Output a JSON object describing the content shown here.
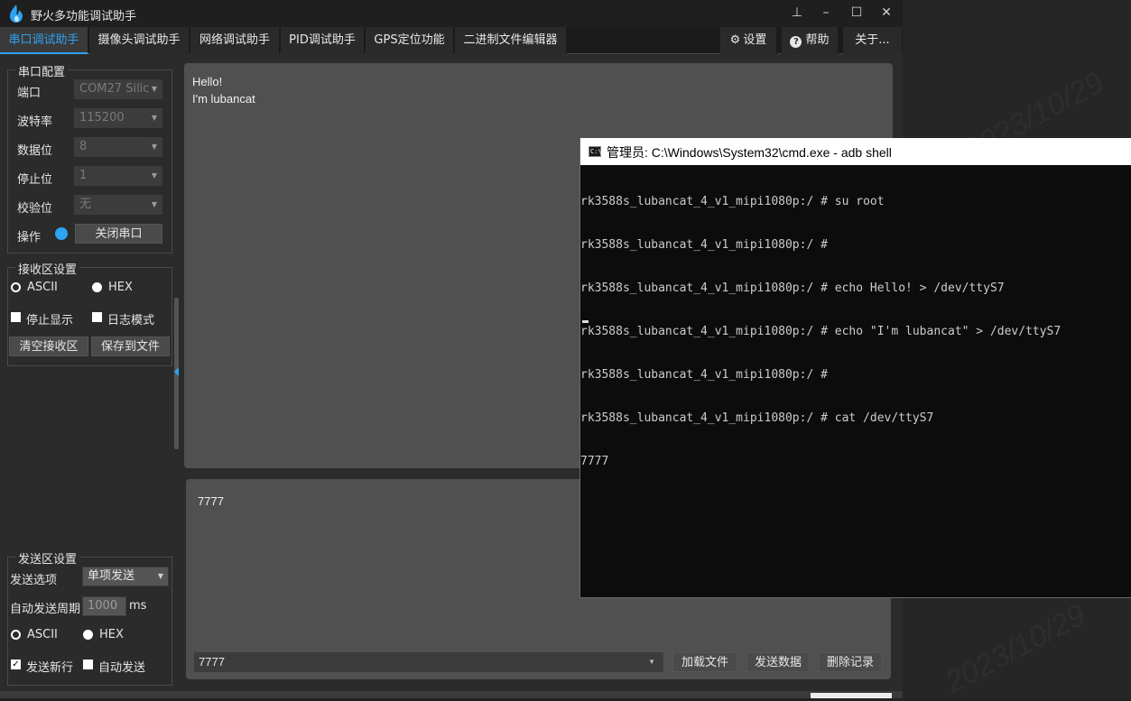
{
  "app": {
    "title": "野火多功能调试助手",
    "window_controls": [
      "pin",
      "minimize",
      "maximize",
      "close"
    ]
  },
  "tabs": [
    {
      "label": "串口调试助手",
      "active": true
    },
    {
      "label": "摄像头调试助手"
    },
    {
      "label": "网络调试助手"
    },
    {
      "label": "PID调试助手"
    },
    {
      "label": "GPS定位功能"
    },
    {
      "label": "二进制文件编辑器"
    }
  ],
  "right_tabs": [
    {
      "label": "设置",
      "icon": "gear-icon"
    },
    {
      "label": "帮助",
      "icon": "help-icon"
    },
    {
      "label": "关于..."
    }
  ],
  "serial_config": {
    "title": "串口配置",
    "port_label": "端口",
    "port_value": "COM27 Silic",
    "baud_label": "波特率",
    "baud_value": "115200",
    "databits_label": "数据位",
    "databits_value": "8",
    "stopbits_label": "停止位",
    "stopbits_value": "1",
    "parity_label": "校验位",
    "parity_value": "无",
    "op_label": "操作",
    "close_button": "关闭串口"
  },
  "recv_settings": {
    "title": "接收区设置",
    "ascii": "ASCII",
    "hex": "HEX",
    "stop_display": "停止显示",
    "log_mode": "日志模式",
    "clear_button": "清空接收区",
    "save_button": "保存到文件"
  },
  "send_settings": {
    "title": "发送区设置",
    "option_label": "发送选项",
    "option_value": "单项发送",
    "period_label": "自动发送周期",
    "period_value": "1000",
    "period_unit": "ms",
    "ascii": "ASCII",
    "hex": "HEX",
    "newline": "发送新行",
    "auto_send": "自动发送"
  },
  "receive_area": {
    "line1": "Hello!",
    "line2": "I'm lubancat"
  },
  "send_area": {
    "text": "7777",
    "combo_value": "7777",
    "load_file": "加载文件",
    "send_data": "发送数据",
    "delete_log": "删除记录"
  },
  "cmd": {
    "title": "管理员: C:\\Windows\\System32\\cmd.exe - adb  shell",
    "lines": [
      "rk3588s_lubancat_4_v1_mipi1080p:/ # su root",
      "rk3588s_lubancat_4_v1_mipi1080p:/ #",
      "rk3588s_lubancat_4_v1_mipi1080p:/ # echo Hello! > /dev/ttyS7",
      "rk3588s_lubancat_4_v1_mipi1080p:/ # echo \"I'm lubancat\" > /dev/ttyS7",
      "rk3588s_lubancat_4_v1_mipi1080p:/ #",
      "rk3588s_lubancat_4_v1_mipi1080p:/ # cat /dev/ttyS7",
      "7777"
    ]
  },
  "colors": {
    "accent": "#2ea3f2",
    "panel": "#505050",
    "background": "#2b2b2b"
  }
}
